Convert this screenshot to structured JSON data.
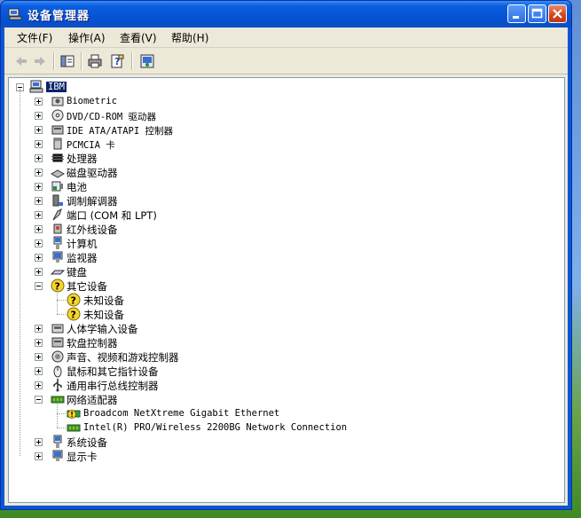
{
  "window": {
    "title": "设备管理器"
  },
  "menu": [
    "文件(F)",
    "操作(A)",
    "查看(V)",
    "帮助(H)"
  ],
  "root": {
    "label": "IBM",
    "icon": "computer-icon"
  },
  "tree": [
    {
      "label": "Biometric",
      "icon": "biometric-icon",
      "expanded": false,
      "mono": true
    },
    {
      "label": "DVD/CD-ROM 驱动器",
      "icon": "cdrom-icon",
      "expanded": false,
      "mono": true
    },
    {
      "label": "IDE ATA/ATAPI 控制器",
      "icon": "ide-controller-icon",
      "expanded": false,
      "mono": true
    },
    {
      "label": "PCMCIA 卡",
      "icon": "pcmcia-icon",
      "expanded": false,
      "mono": true
    },
    {
      "label": "处理器",
      "icon": "processor-icon",
      "expanded": false
    },
    {
      "label": "磁盘驱动器",
      "icon": "disk-drive-icon",
      "expanded": false
    },
    {
      "label": "电池",
      "icon": "battery-icon",
      "expanded": false
    },
    {
      "label": "调制解调器",
      "icon": "modem-icon",
      "expanded": false
    },
    {
      "label": "端口 (COM 和 LPT)",
      "icon": "port-icon",
      "expanded": false
    },
    {
      "label": "红外线设备",
      "icon": "infrared-icon",
      "expanded": false
    },
    {
      "label": "计算机",
      "icon": "computer-small-icon",
      "expanded": false
    },
    {
      "label": "监视器",
      "icon": "monitor-icon",
      "expanded": false
    },
    {
      "label": "键盘",
      "icon": "keyboard-icon",
      "expanded": false
    },
    {
      "label": "其它设备",
      "icon": "other-devices-icon",
      "expanded": true,
      "children": [
        {
          "label": "未知设备",
          "icon": "unknown-device-icon"
        },
        {
          "label": "未知设备",
          "icon": "unknown-device-icon"
        }
      ]
    },
    {
      "label": "人体学输入设备",
      "icon": "hid-icon",
      "expanded": false
    },
    {
      "label": "软盘控制器",
      "icon": "floppy-controller-icon",
      "expanded": false
    },
    {
      "label": "声音、视频和游戏控制器",
      "icon": "sound-icon",
      "expanded": false
    },
    {
      "label": "鼠标和其它指针设备",
      "icon": "mouse-icon",
      "expanded": false
    },
    {
      "label": "通用串行总线控制器",
      "icon": "usb-icon",
      "expanded": false
    },
    {
      "label": "网络适配器",
      "icon": "network-adapter-icon",
      "expanded": true,
      "children": [
        {
          "label": "Broadcom NetXtreme Gigabit Ethernet",
          "icon": "network-card-warning-icon",
          "mono": true
        },
        {
          "label": "Intel(R) PRO/Wireless 2200BG Network Connection",
          "icon": "network-card-icon",
          "mono": true
        }
      ]
    },
    {
      "label": "系统设备",
      "icon": "system-devices-icon",
      "expanded": false
    },
    {
      "label": "显示卡",
      "icon": "display-adapter-icon",
      "expanded": false
    }
  ],
  "toolbar": [
    "back-arrow-icon",
    "forward-arrow-icon",
    "show-hide-tree-icon",
    "print-icon",
    "properties-icon",
    "help-icon"
  ]
}
